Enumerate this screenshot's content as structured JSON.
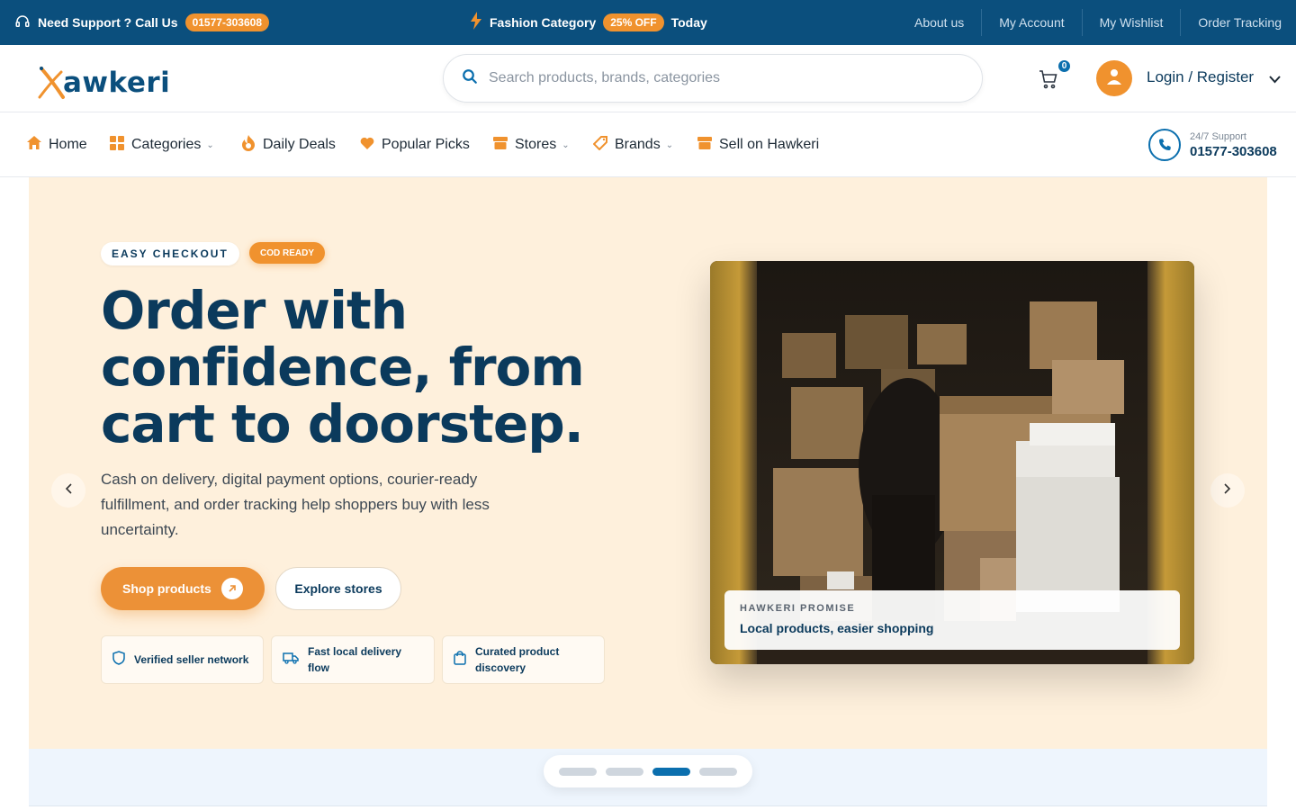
{
  "topbar": {
    "support_label": "Need Support ? Call Us",
    "support_phone": "01577-303608",
    "promo_category": "Fashion Category",
    "promo_badge": "25% OFF",
    "promo_suffix": "Today",
    "links": [
      "About us",
      "My Account",
      "My Wishlist",
      "Order Tracking"
    ]
  },
  "header": {
    "logo_text": "awkeri",
    "search_placeholder": "Search products, brands, categories",
    "cart_count": "0",
    "login_label": "Login / Register"
  },
  "nav": {
    "items": [
      {
        "label": "Home",
        "icon": "home-icon"
      },
      {
        "label": "Categories",
        "icon": "grid-icon"
      },
      {
        "label": "Daily Deals",
        "icon": "flame-icon"
      },
      {
        "label": "Popular Picks",
        "icon": "heart-icon"
      },
      {
        "label": "Stores",
        "icon": "store-icon"
      },
      {
        "label": "Brands",
        "icon": "tag-icon"
      },
      {
        "label": "Sell on Hawkeri",
        "icon": "store-icon"
      }
    ],
    "support_label": "24/7 Support",
    "support_phone": "01577-303608"
  },
  "hero": {
    "tag_primary": "EASY CHECKOUT",
    "tag_secondary": "COD READY",
    "headline": "Order with confidence, from cart to doorstep.",
    "subtext": "Cash on delivery, digital payment options, courier-ready fulfillment, and order tracking help shoppers buy with less uncertainty.",
    "cta_primary": "Shop products",
    "cta_secondary": "Explore stores",
    "features": [
      "Verified seller network",
      "Fast local delivery flow",
      "Curated product discovery"
    ],
    "caption_kicker": "HAWKERI PROMISE",
    "caption_title": "Local products, easier shopping"
  },
  "carousel": {
    "slide_count": 4,
    "active_index": 2
  },
  "colors": {
    "primary": "#0b4f7d",
    "accent": "#f0922e",
    "hero_bg": "#fef0dc"
  }
}
